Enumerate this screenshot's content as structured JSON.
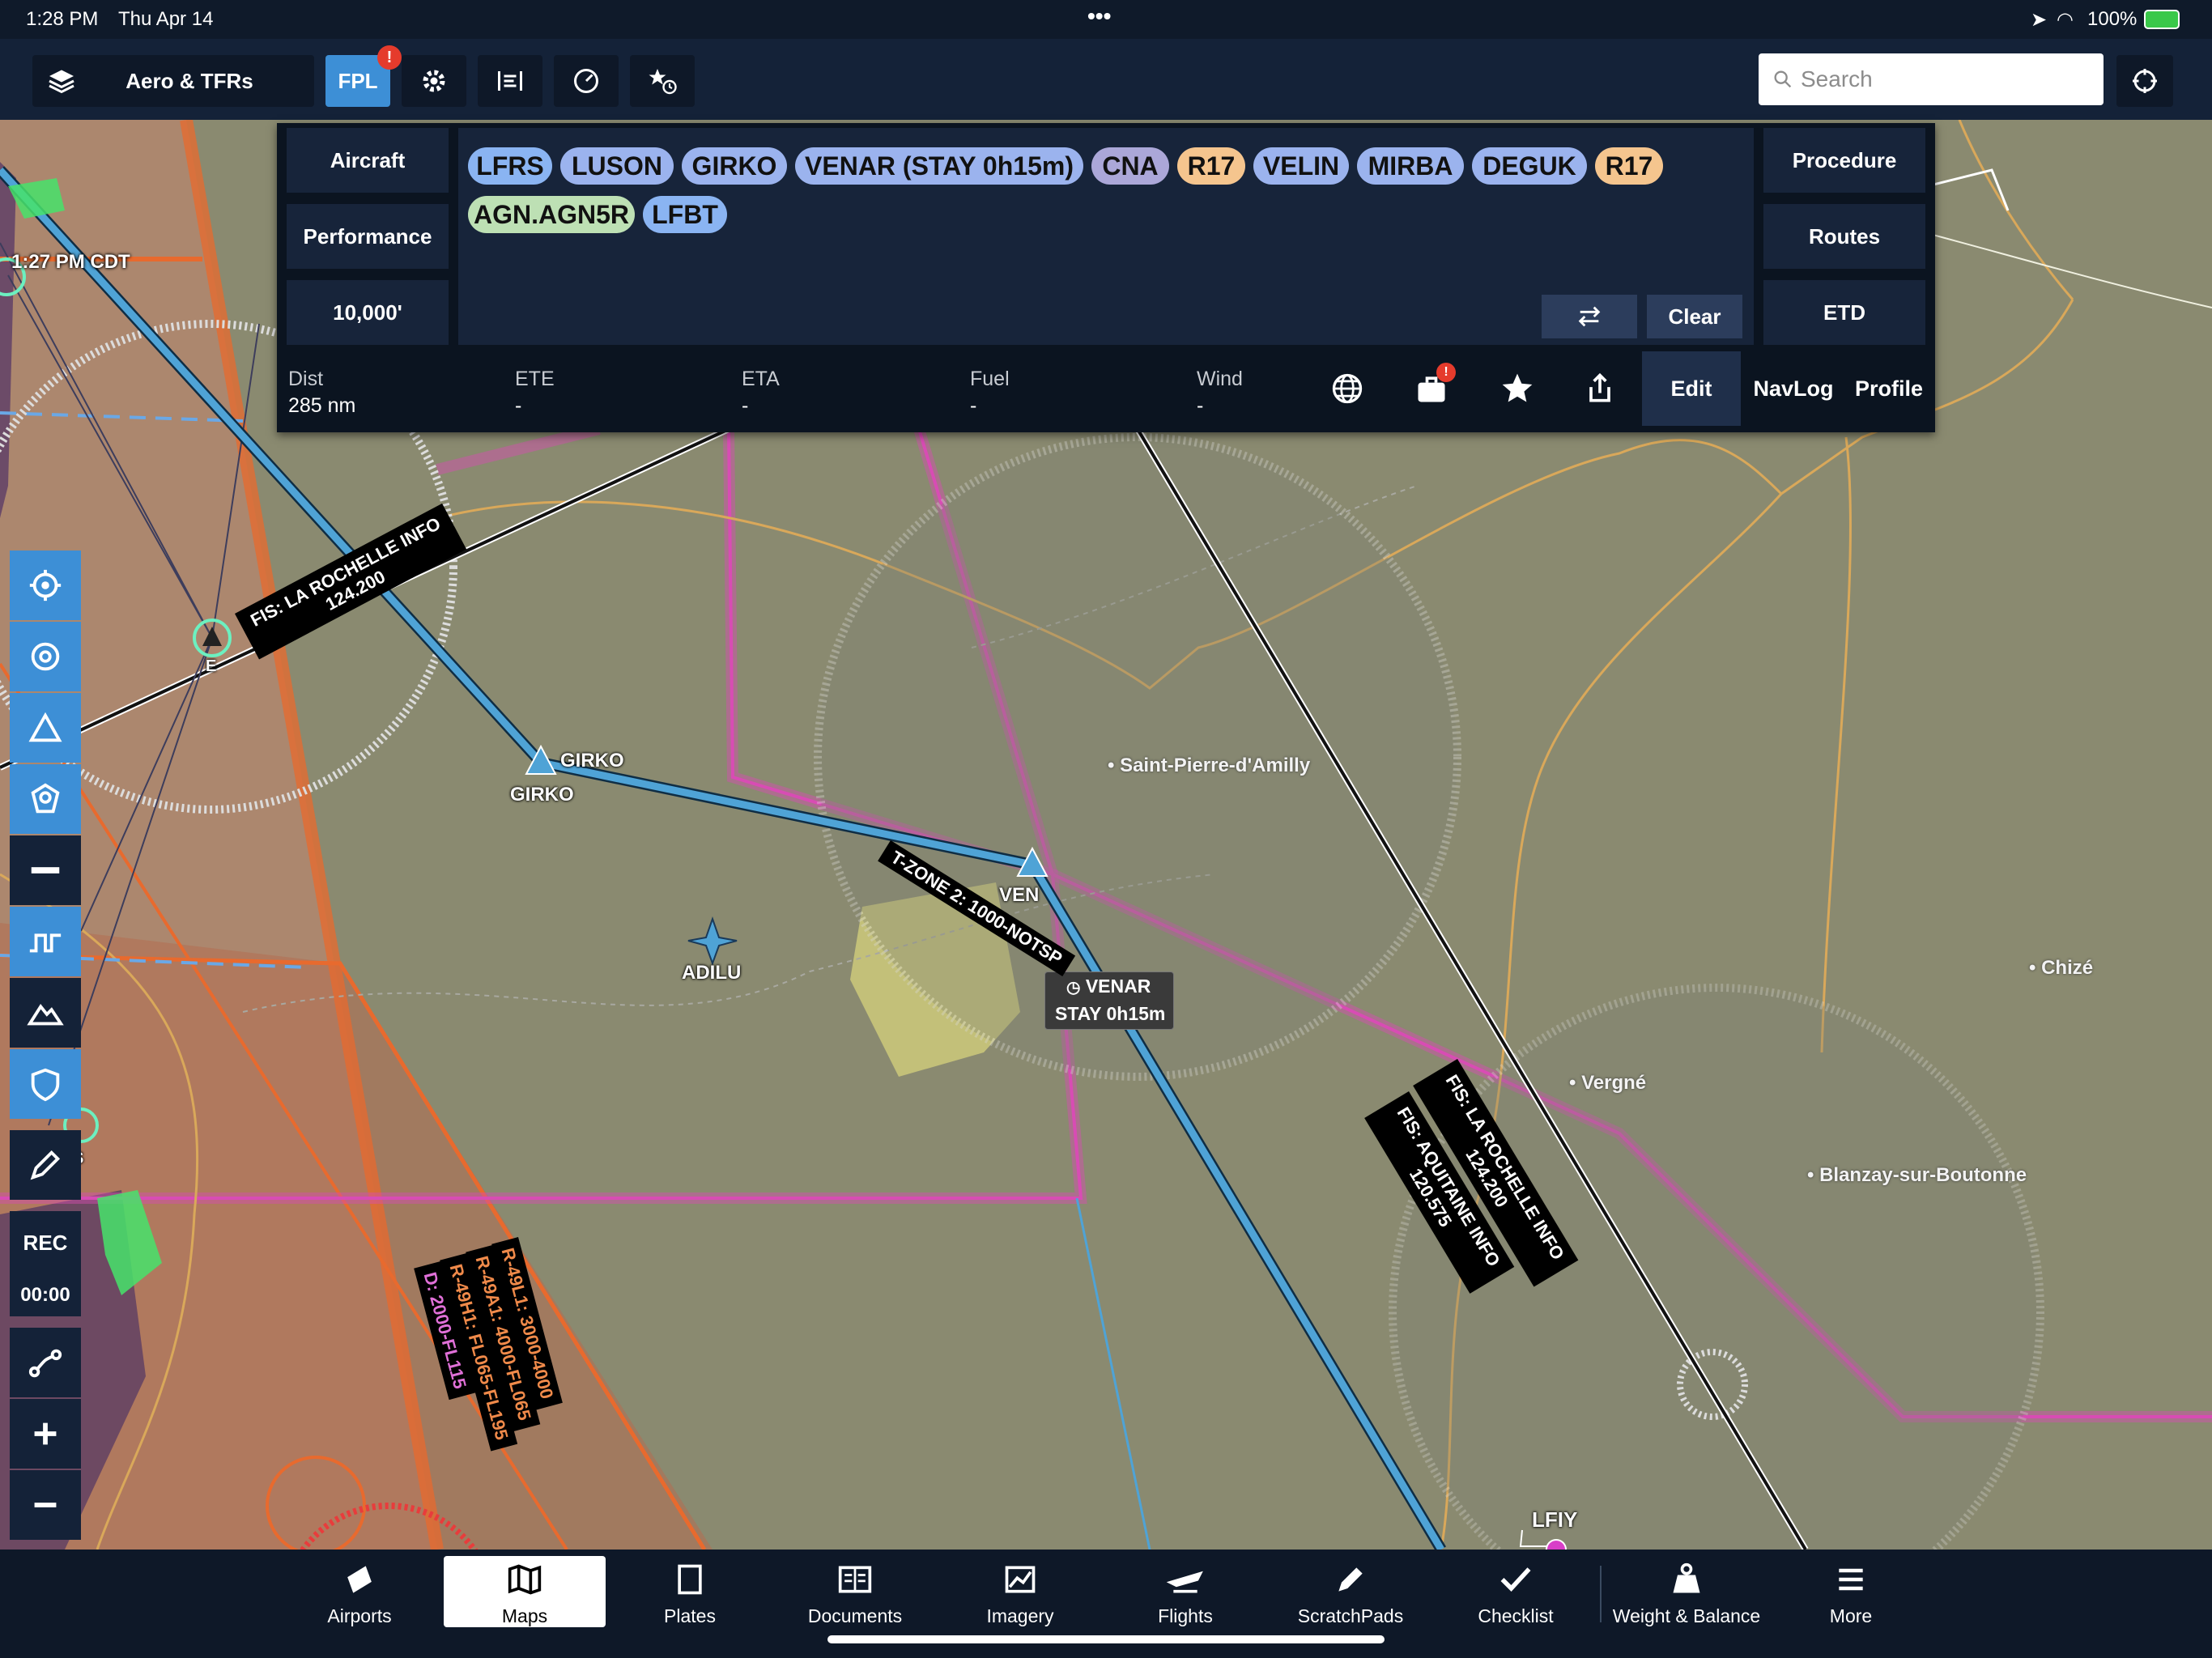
{
  "status_bar": {
    "time": "1:28 PM",
    "date": "Thu Apr 14",
    "dots": "•••",
    "battery": "100%"
  },
  "toolbar": {
    "layers_label": "Aero & TFRs",
    "fpl_label": "FPL",
    "fpl_badge": "!",
    "search_placeholder": "Search"
  },
  "map": {
    "clock": "1:27 PM CDT",
    "waypoints": {
      "girko": "GIRKO",
      "girko2": "GIRKO",
      "adilu": "ADILU",
      "venar": "VENAR",
      "venar_stay": "STAY 0h15m",
      "venar_partial": "VEN",
      "lfiy": "LFIY",
      "e": "E",
      "s": "S"
    },
    "towns": [
      "Saint-Pierre-d'Amilly",
      "Chizé",
      "Vergné",
      "Blanzay-sur-Boutonne"
    ],
    "fis_left": [
      "FIS: LA ROCHELLE INFO",
      "124.200"
    ],
    "fis_right1": [
      "FIS: LA ROCHELLE INFO",
      "124.200"
    ],
    "fis_right2": [
      "FIS: AQUITAINE INFO",
      "120.575"
    ],
    "tzone": "T-ZONE 2: 1000-NOTSP",
    "restricted": [
      "R-49L1: 3000-4000",
      "R-49A1: 4000-FL065",
      "R-49H1: FL065-FL195",
      "D: 2000-FL115"
    ]
  },
  "flight_plan": {
    "left_buttons": [
      "Aircraft",
      "Performance",
      "10,000'"
    ],
    "right_buttons": [
      "Procedure",
      "Routes",
      "ETD"
    ],
    "route_chips": [
      {
        "label": "LFRS",
        "kind": "airport"
      },
      {
        "label": "LUSON",
        "kind": "fix"
      },
      {
        "label": "GIRKO",
        "kind": "fix"
      },
      {
        "label": "VENAR (STAY 0h15m)",
        "kind": "fix"
      },
      {
        "label": "CNA",
        "kind": "vor"
      },
      {
        "label": "R17",
        "kind": "radial"
      },
      {
        "label": "VELIN",
        "kind": "fix"
      },
      {
        "label": "MIRBA",
        "kind": "fix"
      },
      {
        "label": "DEGUK",
        "kind": "fix"
      },
      {
        "label": "R17",
        "kind": "radial"
      },
      {
        "label": "AGN.AGN5R",
        "kind": "procedure"
      },
      {
        "label": "LFBT",
        "kind": "airport"
      }
    ],
    "clear_label": "Clear",
    "stats": [
      {
        "label": "Dist",
        "value": "285 nm"
      },
      {
        "label": "ETE",
        "value": "-"
      },
      {
        "label": "ETA",
        "value": "-"
      },
      {
        "label": "Fuel",
        "value": "-"
      },
      {
        "label": "Wind",
        "value": "-"
      }
    ],
    "tabs": [
      "Edit",
      "NavLog",
      "Profile"
    ],
    "briefcase_badge": "!"
  },
  "left_toolbar": {
    "rec": "REC",
    "timer": "00:00"
  },
  "bottom_nav": [
    "Airports",
    "Maps",
    "Plates",
    "Documents",
    "Imagery",
    "Flights",
    "ScratchPads",
    "Checklist",
    "Weight & Balance",
    "More"
  ],
  "colors": {
    "map_bg": "#8a8a70",
    "route": "#4fa3d6",
    "panel": "#0b1420",
    "accent": "#3d8fd6"
  }
}
